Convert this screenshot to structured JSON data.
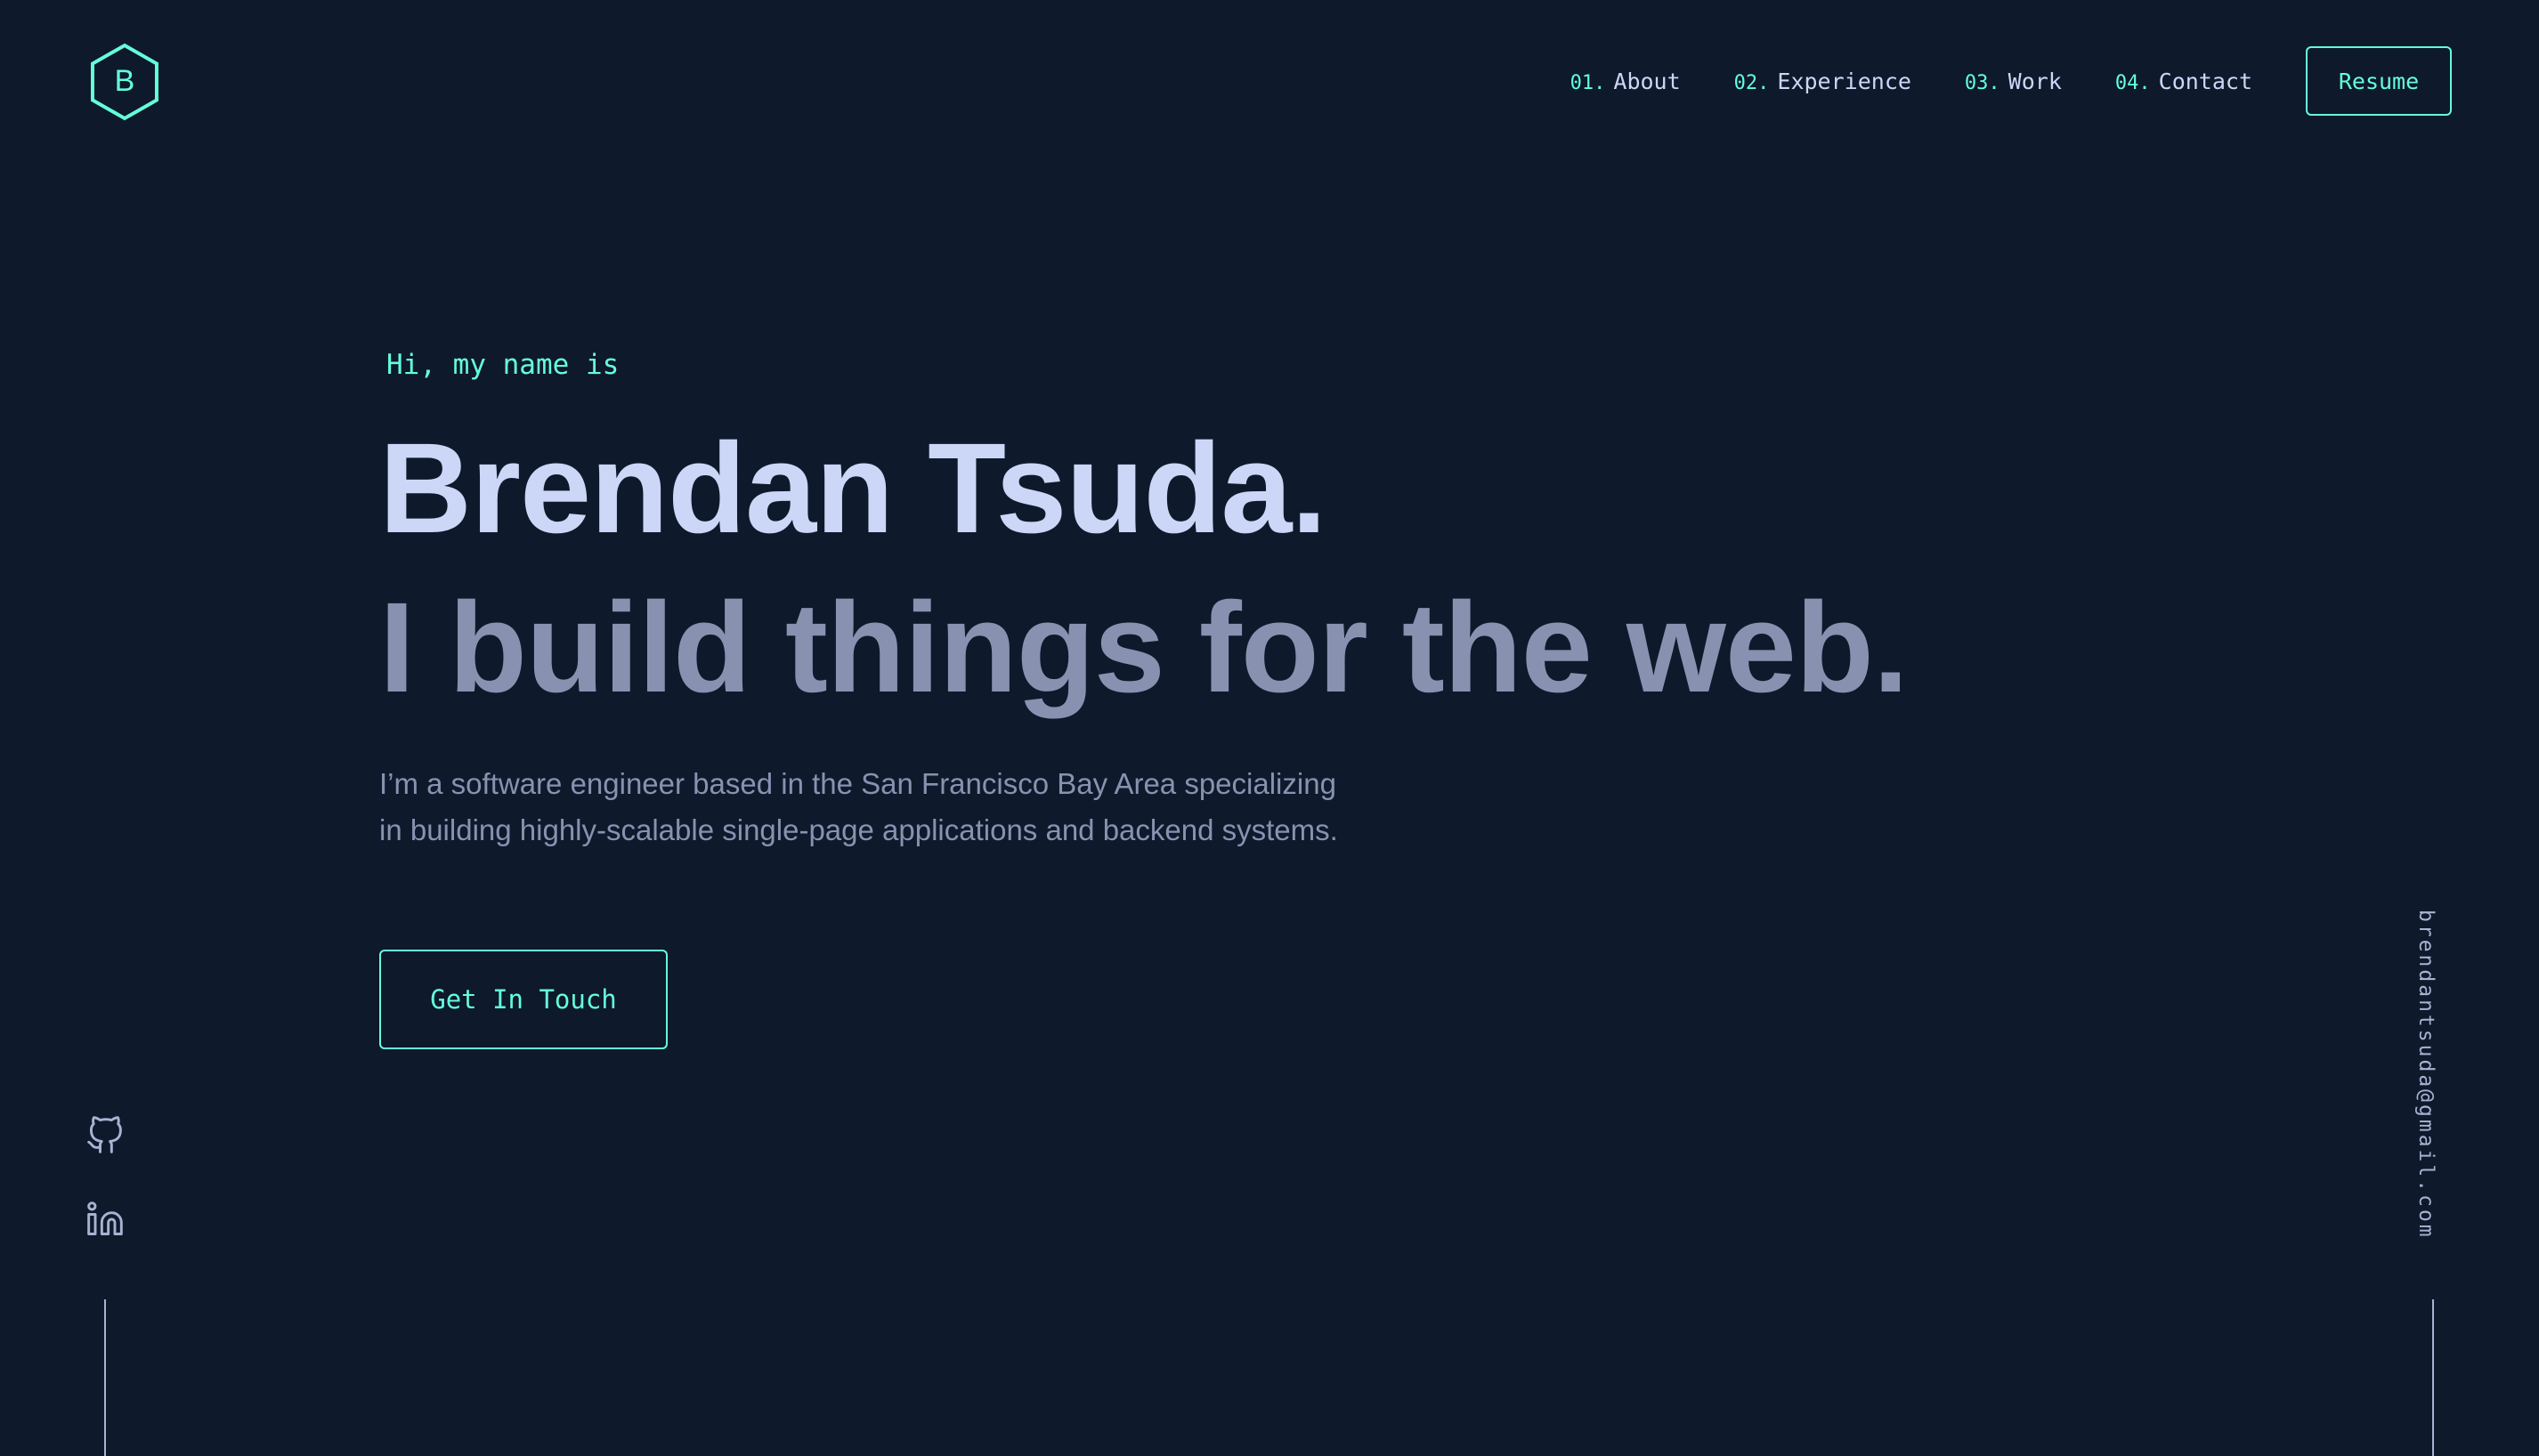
{
  "header": {
    "logo_letter": "B",
    "nav": [
      {
        "num": "01.",
        "label": "About"
      },
      {
        "num": "02.",
        "label": "Experience"
      },
      {
        "num": "03.",
        "label": "Work"
      },
      {
        "num": "04.",
        "label": "Contact"
      }
    ],
    "resume_label": "Resume"
  },
  "hero": {
    "greeting": "Hi, my name is",
    "name": "Brendan Tsuda.",
    "tagline": "I build things for the web.",
    "bio": "I’m a software engineer based in the San Francisco Bay Area specializing in building highly-scalable single-page applications and backend systems.",
    "cta_label": "Get In Touch"
  },
  "socials": {
    "icons": [
      "github-icon",
      "linkedin-icon"
    ]
  },
  "email": "brendantsuda@gmail.com",
  "colors": {
    "background": "#0e192b",
    "accent": "#64ffda",
    "heading": "#ccd6f6",
    "body_text": "#8892b0",
    "line": "#a8b2d1"
  }
}
